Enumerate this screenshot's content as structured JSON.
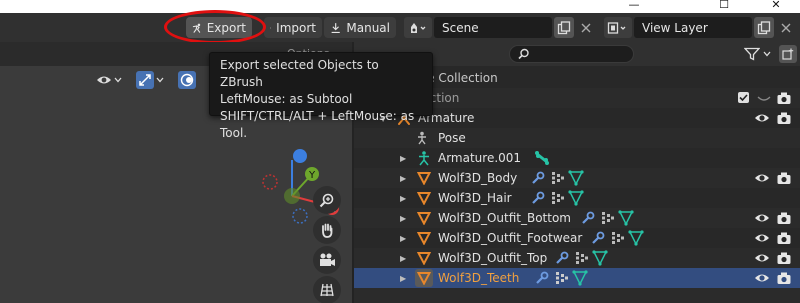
{
  "window": {
    "minimize_glyph": "—",
    "maximize_glyph": "☐",
    "close_glyph": "✕"
  },
  "topbar": {
    "export_label": "Export",
    "import_label": "Import",
    "manual_label": "Manual",
    "scene_name": "Scene",
    "view_layer_name": "View Layer"
  },
  "tooltip": {
    "line1": "Export selected Objects to ZBrush",
    "line2": "LeftMouse: as Subtool",
    "line3": "SHIFT/CTRL/ALT + LeftMouse: as Tool."
  },
  "viewport": {
    "header_label": "Options",
    "gizmo_axes": {
      "x": "X",
      "y": "Y",
      "z": "Z"
    }
  },
  "outliner": {
    "search_placeholder": "",
    "rows": [
      {
        "label": "Scene Collection",
        "icon": "collection-icon"
      },
      {
        "label": "Collection",
        "icon": "collection-icon"
      },
      {
        "label": "Armature",
        "icon": "armature-icon"
      },
      {
        "label": "Pose",
        "icon": "pose-icon"
      },
      {
        "label": "Armature.001",
        "icon": "armature-icon"
      },
      {
        "label": "Wolf3D_Body",
        "icon": "mesh-icon"
      },
      {
        "label": "Wolf3D_Hair",
        "icon": "mesh-icon"
      },
      {
        "label": "Wolf3D_Outfit_Bottom",
        "icon": "mesh-icon"
      },
      {
        "label": "Wolf3D_Outfit_Footwear",
        "icon": "mesh-icon"
      },
      {
        "label": "Wolf3D_Outfit_Top",
        "icon": "mesh-icon"
      },
      {
        "label": "Wolf3D_Teeth",
        "icon": "mesh-icon",
        "selected": true
      }
    ]
  },
  "colors": {
    "accent_blue": "#4772b3",
    "selection_row": "#334d80",
    "selected_label": "#f0a040",
    "annotation_red": "#e01010",
    "axis_x": "#e03c3c",
    "axis_y": "#6ea72c",
    "axis_z": "#3c7fe0",
    "mesh_orange": "#e8872b",
    "modifier_blue": "#6d9be0",
    "vertex_group_green": "#27c3a6"
  }
}
